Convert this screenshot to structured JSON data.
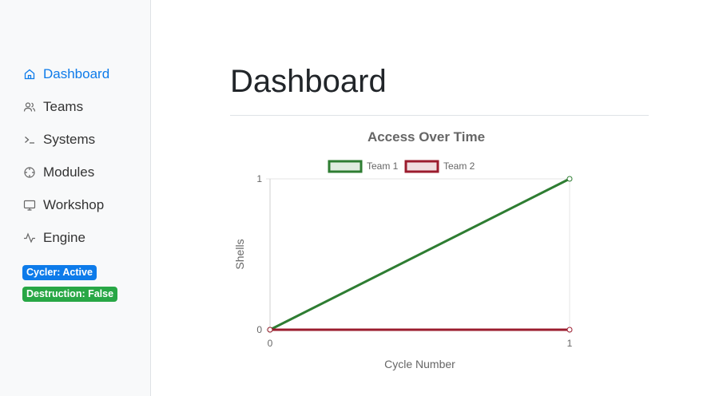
{
  "sidebar": {
    "items": [
      {
        "label": "Dashboard",
        "icon": "home-icon",
        "active": true
      },
      {
        "label": "Teams",
        "icon": "users-icon"
      },
      {
        "label": "Systems",
        "icon": "terminal-icon"
      },
      {
        "label": "Modules",
        "icon": "crosshair-icon"
      },
      {
        "label": "Workshop",
        "icon": "monitor-icon"
      },
      {
        "label": "Engine",
        "icon": "activity-icon"
      }
    ],
    "badges": {
      "cycler": "Cycler: Active",
      "destruction": "Destruction: False"
    }
  },
  "main": {
    "title": "Dashboard"
  },
  "colors": {
    "accent": "#0d7bea",
    "badge_blue": "#0d7bea",
    "badge_green": "#28a745",
    "team1": "#2e7d32",
    "team2": "#9b1c2e"
  },
  "chart_data": {
    "type": "line",
    "title": "Access Over Time",
    "xlabel": "Cycle Number",
    "ylabel": "Shells",
    "x": [
      0,
      1
    ],
    "xlim": [
      0,
      1
    ],
    "ylim": [
      0,
      1
    ],
    "xticks": [
      "0",
      "1"
    ],
    "yticks": [
      "0",
      "1"
    ],
    "legend_position": "top",
    "grid": true,
    "series": [
      {
        "name": "Team 1",
        "values": [
          0,
          1
        ],
        "color": "#2e7d32"
      },
      {
        "name": "Team 2",
        "values": [
          0,
          0
        ],
        "color": "#9b1c2e"
      }
    ]
  }
}
